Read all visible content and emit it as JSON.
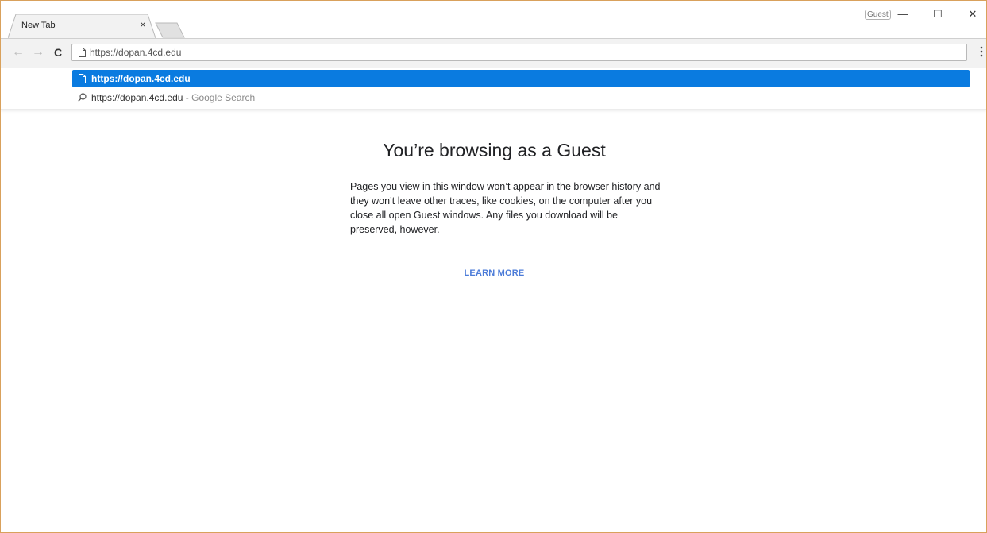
{
  "tab": {
    "title": "New Tab",
    "close_glyph": "×"
  },
  "profile": {
    "label": "Guest"
  },
  "window_controls": {
    "minimize": "—",
    "maximize": "☐",
    "close": "✕"
  },
  "toolbar": {
    "back_glyph": "←",
    "forward_glyph": "→",
    "reload_glyph": "C",
    "omnibox_value": "https://dopan.4cd.edu"
  },
  "dropdown": {
    "selected": {
      "text": "https://dopan.4cd.edu",
      "icon": "page-icon"
    },
    "search": {
      "text": "https://dopan.4cd.edu",
      "separator": " - ",
      "description": "Google Search",
      "icon": "search-icon"
    }
  },
  "content": {
    "heading": "You’re browsing as a Guest",
    "paragraph": "Pages you view in this window won’t appear in the browser history and they won’t leave other traces, like cookies, on the computer after you close all open Guest windows. Any files you download will be preserved, however.",
    "learn_more": "LEARN MORE"
  },
  "colors": {
    "accent_selected": "#0a7be0",
    "link": "#4b7bd8",
    "window_border": "#d9a15c"
  }
}
